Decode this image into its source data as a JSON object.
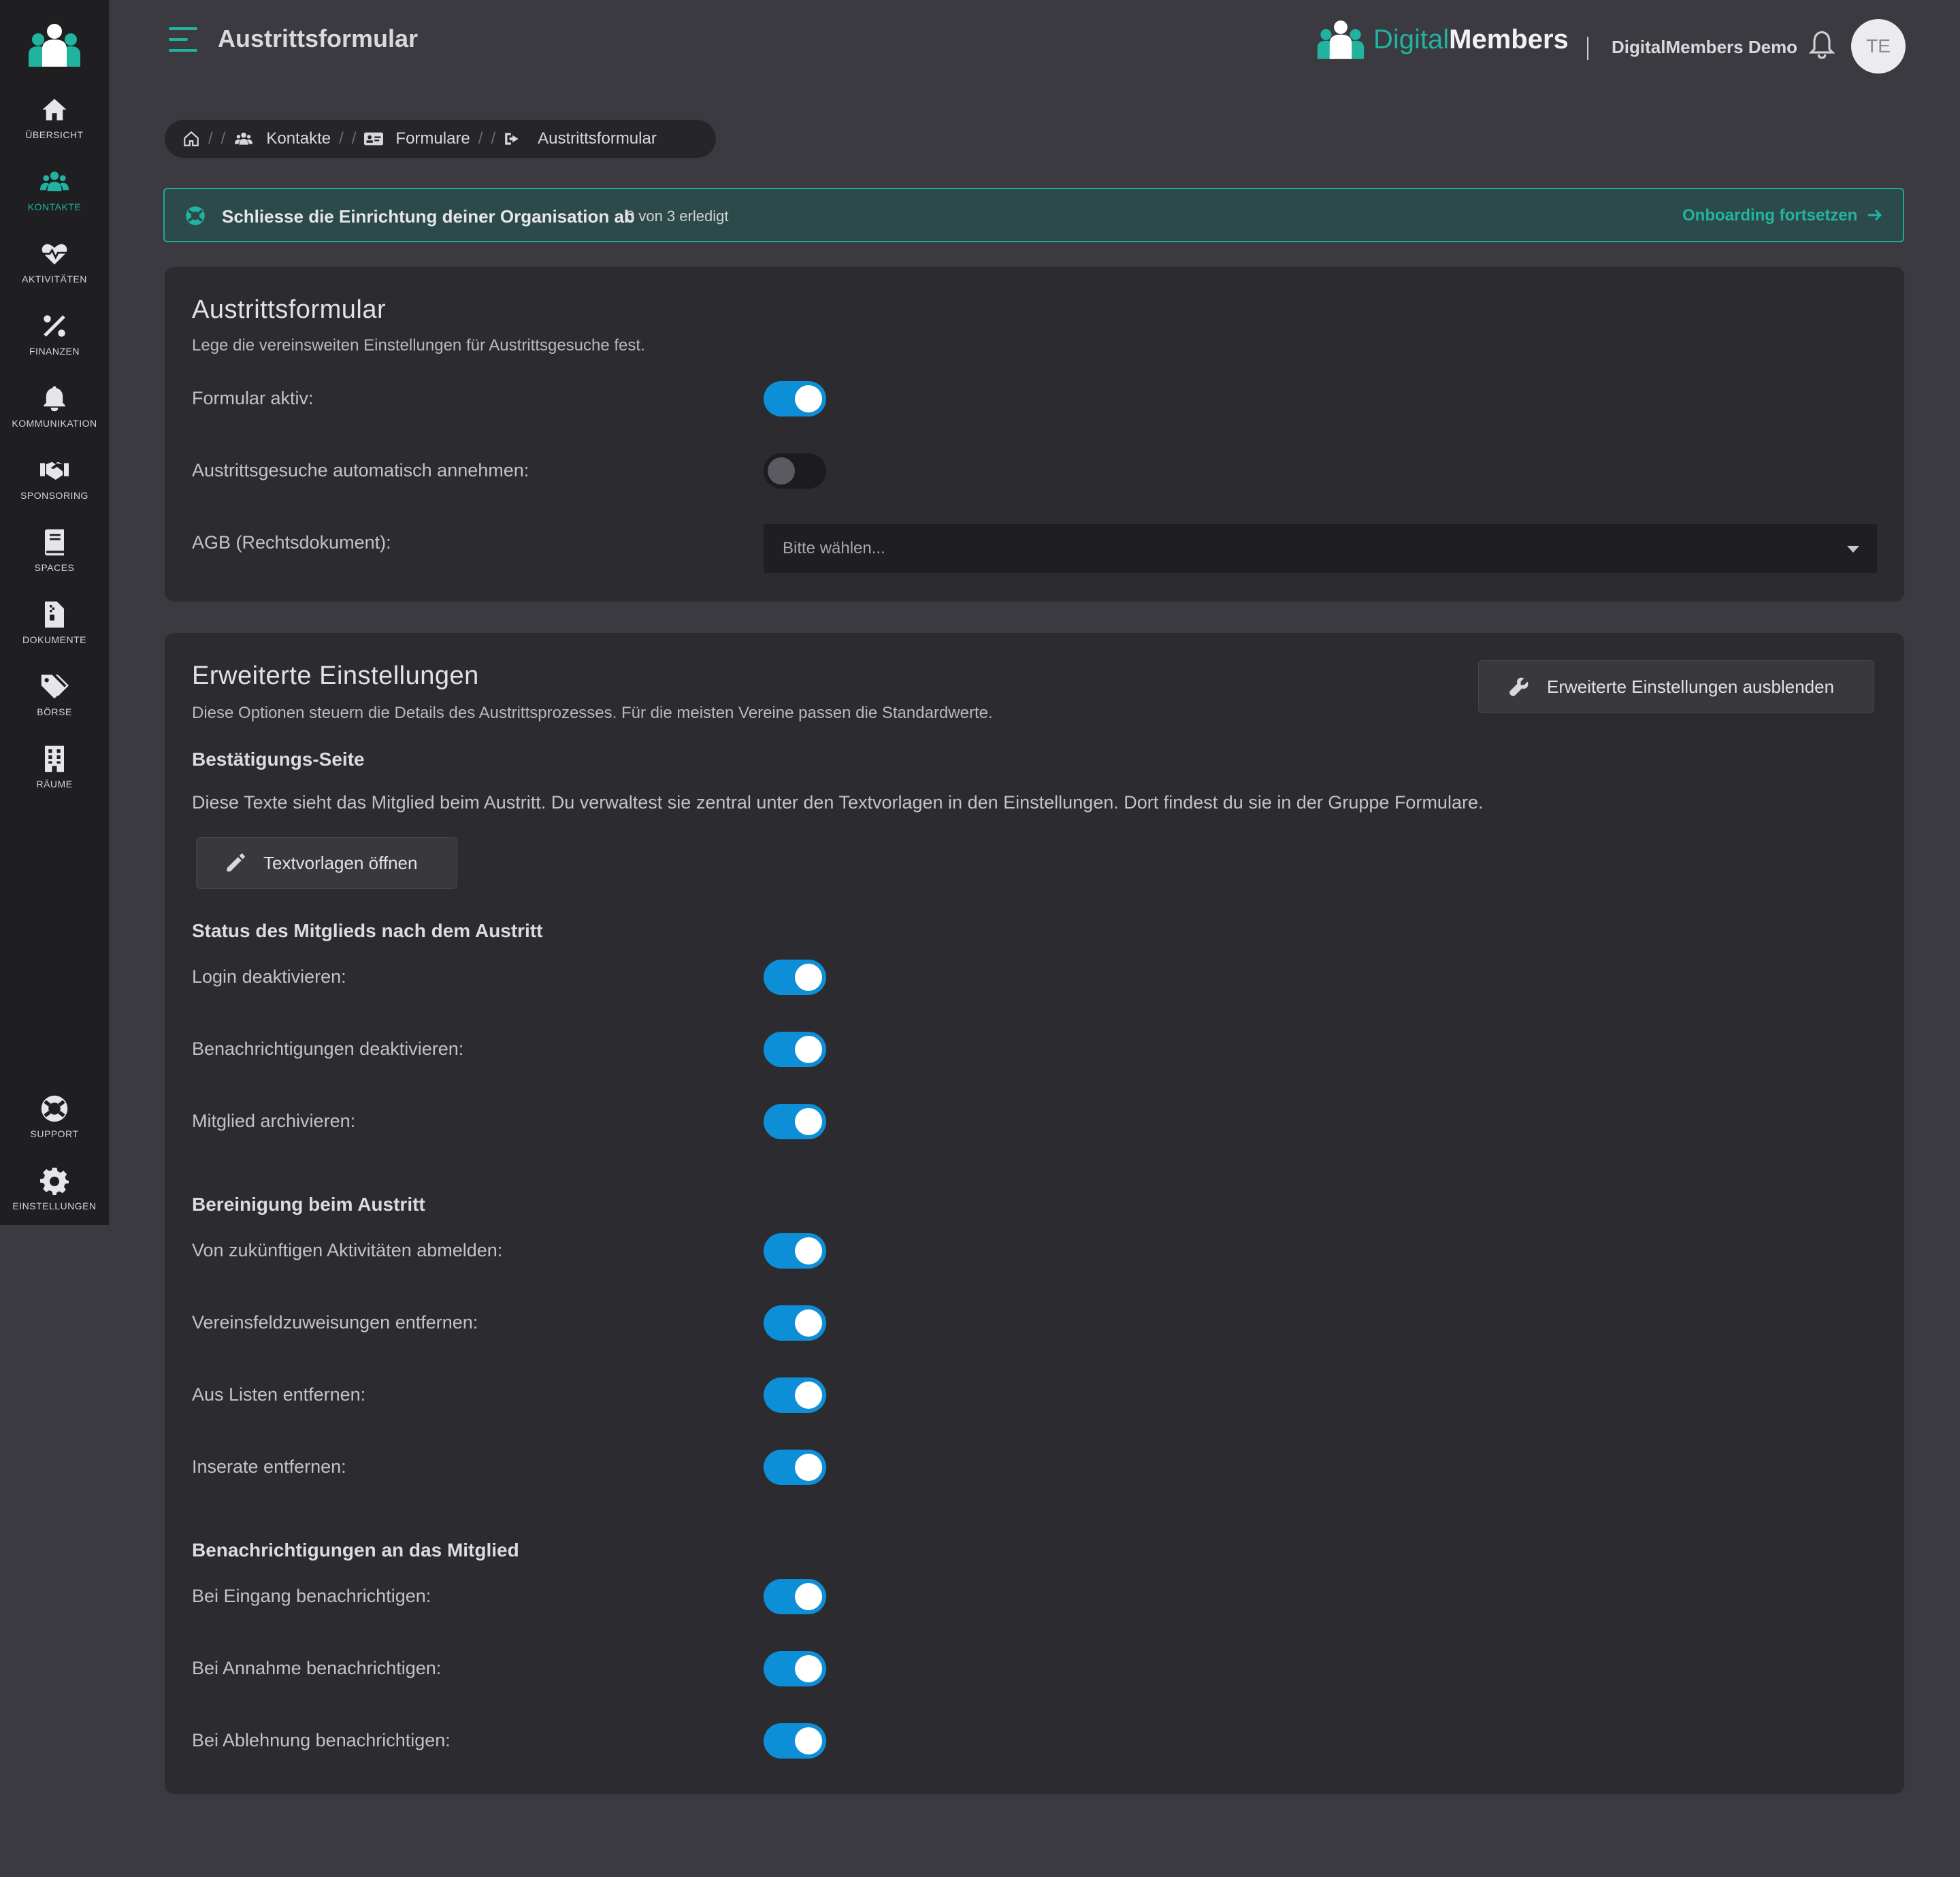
{
  "sidebar": {
    "items": [
      {
        "label": "Übersicht",
        "icon": "home-icon"
      },
      {
        "label": "Kontakte",
        "icon": "users-icon",
        "active": true
      },
      {
        "label": "Aktivitäten",
        "icon": "heartbeat-icon"
      },
      {
        "label": "Finanzen",
        "icon": "percent-icon"
      },
      {
        "label": "Kommunikation",
        "icon": "bell-icon"
      },
      {
        "label": "Sponsoring",
        "icon": "handshake-icon"
      },
      {
        "label": "Spaces",
        "icon": "book-icon"
      },
      {
        "label": "Dokumente",
        "icon": "file-archive-icon"
      },
      {
        "label": "Börse",
        "icon": "tags-icon"
      },
      {
        "label": "Räume",
        "icon": "building-icon"
      }
    ],
    "bottom": [
      {
        "label": "Support",
        "icon": "lifebuoy-icon"
      },
      {
        "label": "Einstellungen",
        "icon": "gear-icon"
      }
    ]
  },
  "header": {
    "title": "Austrittsformular",
    "brand_digital": "Digital",
    "brand_members": "Members",
    "org": "DigitalMembers Demo",
    "avatar": "TE"
  },
  "breadcrumb": {
    "items": [
      "Kontakte",
      "Formulare",
      "Austrittsformular"
    ]
  },
  "onboarding": {
    "title": "Schliesse die Einrichtung deiner Organisation ab",
    "count": "0 von 3 erledigt",
    "link": "Onboarding fortsetzen"
  },
  "form_card": {
    "title": "Austrittsformular",
    "subtitle": "Lege die vereinsweiten Einstellungen für Austrittsgesuche fest.",
    "active_label": "Formular aktiv:",
    "active_value": true,
    "auto_label": "Austrittsgesuche automatisch annehmen:",
    "auto_value": false,
    "agb_label": "AGB (Rechtsdokument):",
    "agb_placeholder": "Bitte wählen..."
  },
  "advanced": {
    "title": "Erweiterte Einstellungen",
    "subtitle": "Diese Optionen steuern die Details des Austrittsprozesses. Für die meisten Vereine passen die Standardwerte.",
    "hide_button": "Erweiterte Einstellungen ausblenden",
    "confirm_head": "Bestätigungs-Seite",
    "confirm_text": "Diese Texte sieht das Mitglied beim Austritt. Du verwaltest sie zentral unter den Textvorlagen in den Einstellungen. Dort findest du sie in der Gruppe Formulare.",
    "templates_button": "Textvorlagen öffnen",
    "status_head": "Status des Mitglieds nach dem Austritt",
    "status_rows": [
      {
        "label": "Login deaktivieren:",
        "on": true
      },
      {
        "label": "Benachrichtigungen deaktivieren:",
        "on": true
      },
      {
        "label": "Mitglied archivieren:",
        "on": true
      }
    ],
    "cleanup_head": "Bereinigung beim Austritt",
    "cleanup_rows": [
      {
        "label": "Von zukünftigen Aktivitäten abmelden:",
        "on": true
      },
      {
        "label": "Vereinsfeldzuweisungen entfernen:",
        "on": true
      },
      {
        "label": "Aus Listen entfernen:",
        "on": true
      },
      {
        "label": "Inserate entfernen:",
        "on": true
      }
    ],
    "notify_head": "Benachrichtigungen an das Mitglied",
    "notify_rows": [
      {
        "label": "Bei Eingang benachrichtigen:",
        "on": true
      },
      {
        "label": "Bei Annahme benachrichtigen:",
        "on": true
      },
      {
        "label": "Bei Ablehnung benachrichtigen:",
        "on": true
      }
    ]
  },
  "colors": {
    "accent": "#22b3a0",
    "toggle_on": "#0d8fd8",
    "background": "#3a3a40",
    "card": "#2c2c30",
    "sidebar": "#1f1f22"
  }
}
